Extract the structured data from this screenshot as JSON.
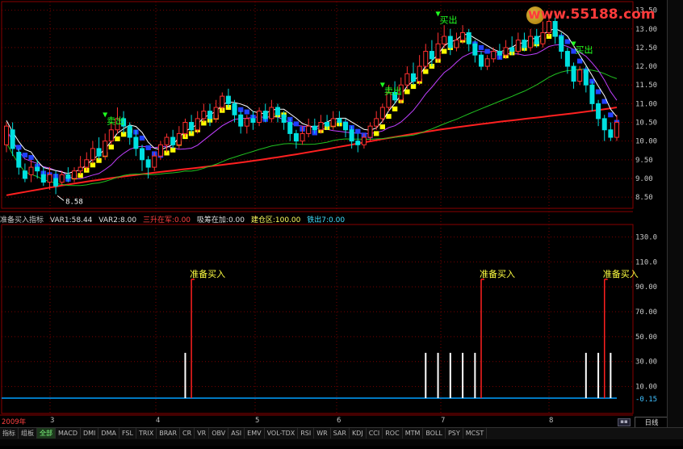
{
  "watermark": "www.55188.com",
  "indicator_bar": {
    "name": "准备买入指标",
    "var1": "VAR1:58.44",
    "var2": "VAR2:8.00",
    "v3": "三升在军:0.00",
    "v4": "吸筹在加:0.00",
    "v5": "建仓区:100.00",
    "v6": "铁出7:0.00"
  },
  "colors": {
    "up": "#ff3030",
    "down": "#00e0e0",
    "ma_long": "#ff2020",
    "ma_mid": "#20c020",
    "ma_fast": "#c040ff",
    "ma_white": "#ffffff",
    "yellow_band": "#ffff00",
    "blue_band": "#2040ff",
    "grid": "#7a0000",
    "baseline": "#00a0ff"
  },
  "main_y_ticks": [
    "13.50",
    "13.00",
    "12.50",
    "12.00",
    "11.50",
    "11.00",
    "10.50",
    "10.00",
    "9.50",
    "9.00",
    "8.50"
  ],
  "sub_y_ticks": [
    "130.0",
    "110.0",
    "90.00",
    "70.00",
    "50.00",
    "30.00",
    "10.00",
    "-0.15"
  ],
  "date_labels": [
    "2009年",
    "3",
    "4",
    "5",
    "6",
    "7",
    "8"
  ],
  "right_control": "日线",
  "tabs": [
    "指标",
    "组板",
    "全部",
    "MACD",
    "DMI",
    "DMA",
    "FSL",
    "TRIX",
    "BRAR",
    "CR",
    "VR",
    "OBV",
    "ASI",
    "EMV",
    "VOL-TDX",
    "RSI",
    "WR",
    "SAR",
    "KDJ",
    "CCI",
    "ROC",
    "MTM",
    "BOLL",
    "PSY",
    "MCST"
  ],
  "chart_data": {
    "type": "candlestick",
    "ylim": [
      8.2,
      13.6
    ],
    "low_marker": "8.58",
    "signal_labels": [
      "卖出",
      "买出",
      "卖出",
      "买出"
    ],
    "sub_chart": {
      "type": "bar",
      "ylim": [
        0,
        140
      ],
      "signal_text": "准备买入",
      "tall_signals_at": [
        30,
        77,
        97,
        150,
        180,
        187,
        193
      ],
      "short_bars_at": [
        29,
        68,
        70,
        72,
        74,
        76,
        94,
        96,
        98,
        148,
        177,
        179,
        182,
        185,
        188,
        190
      ]
    },
    "ohlc": [
      [
        9.9,
        10.4,
        10.5,
        9.7
      ],
      [
        10.3,
        9.8,
        10.5,
        9.6
      ],
      [
        9.7,
        9.3,
        9.8,
        9.1
      ],
      [
        9.2,
        9.0,
        9.4,
        8.9
      ],
      [
        9.1,
        9.3,
        9.5,
        8.9
      ],
      [
        9.3,
        9.2,
        9.5,
        9.0
      ],
      [
        9.1,
        8.9,
        9.3,
        8.8
      ],
      [
        8.9,
        9.1,
        9.3,
        8.7
      ],
      [
        9.0,
        8.8,
        9.2,
        8.58
      ],
      [
        8.9,
        9.1,
        9.2,
        8.8
      ],
      [
        9.1,
        9.0,
        9.3,
        8.9
      ],
      [
        9.0,
        9.2,
        9.3,
        8.9
      ],
      [
        9.2,
        9.3,
        9.6,
        9.1
      ],
      [
        9.3,
        9.5,
        9.7,
        9.2
      ],
      [
        9.5,
        9.8,
        10.0,
        9.4
      ],
      [
        9.8,
        9.6,
        10.1,
        9.5
      ],
      [
        9.6,
        10.0,
        10.2,
        9.5
      ],
      [
        10.0,
        10.3,
        10.5,
        9.9
      ],
      [
        10.3,
        10.6,
        10.9,
        10.2
      ],
      [
        10.6,
        10.4,
        10.8,
        10.2
      ],
      [
        10.4,
        10.1,
        10.5,
        9.9
      ],
      [
        10.1,
        9.8,
        10.3,
        9.6
      ],
      [
        9.8,
        9.5,
        9.9,
        9.2
      ],
      [
        9.5,
        9.3,
        9.6,
        9.0
      ],
      [
        9.3,
        9.6,
        9.7,
        9.2
      ],
      [
        9.6,
        9.9,
        10.0,
        9.5
      ],
      [
        9.9,
        10.1,
        10.2,
        9.7
      ],
      [
        10.1,
        9.9,
        10.3,
        9.8
      ],
      [
        9.9,
        10.2,
        10.4,
        9.8
      ],
      [
        10.2,
        10.5,
        10.6,
        10.1
      ],
      [
        10.5,
        10.3,
        10.7,
        10.2
      ],
      [
        10.3,
        10.6,
        10.8,
        10.2
      ],
      [
        10.6,
        10.8,
        11.0,
        10.5
      ],
      [
        10.8,
        10.6,
        11.0,
        10.4
      ],
      [
        10.6,
        10.9,
        11.1,
        10.5
      ],
      [
        10.9,
        11.2,
        11.3,
        10.8
      ],
      [
        11.2,
        11.0,
        11.4,
        10.9
      ],
      [
        11.0,
        10.7,
        11.1,
        10.5
      ],
      [
        10.7,
        10.4,
        10.8,
        10.2
      ],
      [
        10.4,
        10.6,
        10.7,
        10.2
      ],
      [
        10.6,
        10.5,
        10.8,
        10.3
      ],
      [
        10.5,
        10.8,
        10.9,
        10.4
      ],
      [
        10.8,
        10.6,
        11.0,
        10.5
      ],
      [
        10.6,
        10.9,
        11.1,
        10.5
      ],
      [
        10.9,
        10.7,
        11.0,
        10.5
      ],
      [
        10.7,
        10.5,
        10.8,
        10.3
      ],
      [
        10.5,
        10.2,
        10.6,
        10.0
      ],
      [
        10.2,
        10.0,
        10.3,
        9.8
      ],
      [
        10.0,
        10.2,
        10.4,
        9.9
      ],
      [
        10.2,
        10.4,
        10.6,
        10.1
      ],
      [
        10.4,
        10.3,
        10.6,
        10.2
      ],
      [
        10.3,
        10.5,
        10.7,
        10.2
      ],
      [
        10.5,
        10.4,
        10.7,
        10.3
      ],
      [
        10.4,
        10.6,
        10.8,
        10.3
      ],
      [
        10.6,
        10.5,
        10.8,
        10.4
      ],
      [
        10.5,
        10.3,
        10.6,
        10.1
      ],
      [
        10.3,
        10.0,
        10.4,
        9.8
      ],
      [
        10.0,
        9.9,
        10.2,
        9.7
      ],
      [
        9.9,
        10.1,
        10.2,
        9.8
      ],
      [
        10.1,
        10.4,
        10.5,
        10.0
      ],
      [
        10.4,
        10.6,
        10.8,
        10.3
      ],
      [
        10.6,
        10.9,
        11.0,
        10.5
      ],
      [
        10.9,
        11.3,
        11.5,
        10.8
      ],
      [
        11.3,
        11.1,
        11.6,
        11.0
      ],
      [
        11.1,
        11.5,
        11.7,
        11.0
      ],
      [
        11.5,
        11.8,
        12.0,
        11.4
      ],
      [
        11.8,
        11.6,
        12.1,
        11.5
      ],
      [
        11.6,
        12.0,
        12.3,
        11.5
      ],
      [
        12.0,
        12.4,
        12.6,
        11.9
      ],
      [
        12.4,
        12.2,
        12.7,
        12.0
      ],
      [
        12.2,
        12.6,
        12.9,
        12.1
      ],
      [
        12.6,
        12.8,
        13.1,
        12.5
      ],
      [
        12.8,
        12.5,
        13.0,
        12.3
      ],
      [
        12.5,
        12.7,
        12.9,
        12.4
      ],
      [
        12.7,
        12.9,
        13.1,
        12.6
      ],
      [
        12.9,
        12.6,
        13.0,
        12.4
      ],
      [
        12.6,
        12.3,
        12.7,
        12.1
      ],
      [
        12.3,
        12.0,
        12.4,
        11.9
      ],
      [
        12.0,
        12.2,
        12.3,
        11.9
      ],
      [
        12.2,
        12.4,
        12.5,
        12.1
      ],
      [
        12.4,
        12.3,
        12.6,
        12.2
      ],
      [
        12.3,
        12.5,
        12.7,
        12.2
      ],
      [
        12.5,
        12.4,
        12.8,
        12.3
      ],
      [
        12.4,
        12.7,
        12.9,
        12.3
      ],
      [
        12.7,
        12.5,
        12.9,
        12.4
      ],
      [
        12.5,
        12.8,
        13.0,
        12.4
      ],
      [
        12.8,
        12.6,
        13.0,
        12.5
      ],
      [
        12.6,
        12.9,
        13.2,
        12.5
      ],
      [
        12.9,
        13.2,
        13.4,
        12.8
      ],
      [
        13.2,
        12.8,
        13.3,
        12.6
      ],
      [
        12.8,
        12.4,
        12.9,
        12.2
      ],
      [
        12.4,
        12.0,
        12.5,
        11.8
      ],
      [
        12.0,
        11.6,
        12.1,
        11.4
      ],
      [
        11.6,
        11.9,
        12.0,
        11.5
      ],
      [
        11.9,
        11.5,
        12.0,
        11.3
      ],
      [
        11.5,
        11.0,
        11.6,
        10.8
      ],
      [
        11.0,
        10.6,
        11.1,
        10.4
      ],
      [
        10.6,
        10.3,
        10.7,
        10.0
      ],
      [
        10.3,
        10.1,
        10.5,
        10.0
      ],
      [
        10.1,
        10.5,
        10.7,
        10.0
      ]
    ]
  }
}
